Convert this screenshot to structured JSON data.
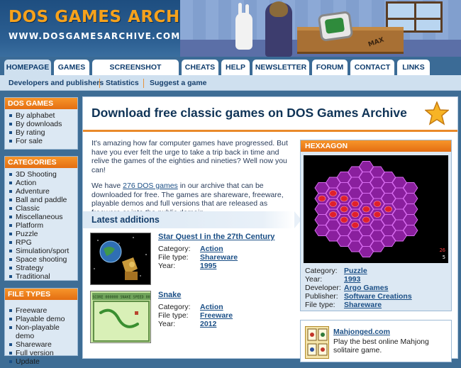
{
  "header": {
    "title": "DOS GAMES ARCHIVE",
    "url": "WWW.DOSGAMESARCHIVE.COM",
    "scene_sign": "MAX"
  },
  "nav": {
    "tabs": [
      {
        "label": "HOMEPAGE",
        "active": true
      },
      {
        "label": "GAMES"
      },
      {
        "label": "SCREENSHOT GALLERY"
      },
      {
        "label": "CHEATS"
      },
      {
        "label": "HELP"
      },
      {
        "label": "NEWSLETTER"
      },
      {
        "label": "FORUM"
      },
      {
        "label": "CONTACT"
      },
      {
        "label": "LINKS"
      }
    ],
    "subnav": [
      "Developers and publishers",
      "Statistics",
      "Suggest a game"
    ]
  },
  "sidebar": {
    "dos_games": {
      "title": "DOS GAMES",
      "items": [
        "By alphabet",
        "By downloads",
        "By rating",
        "For sale"
      ]
    },
    "categories": {
      "title": "CATEGORIES",
      "items": [
        "3D Shooting",
        "Action",
        "Adventure",
        "Ball and paddle",
        "Classic",
        "Miscellaneous",
        "Platform",
        "Puzzle",
        "RPG",
        "Simulation/sport",
        "Space shooting",
        "Strategy",
        "Traditional"
      ]
    },
    "file_types": {
      "title": "FILE TYPES",
      "items": [
        "Freeware",
        "Playable demo",
        "Non-playable demo",
        "Shareware",
        "Full version",
        "Update"
      ]
    }
  },
  "main": {
    "title": "Download free classic games on DOS Games Archive",
    "intro_p1": "It's amazing how far computer games have progressed. But have you ever felt the urge to take a trip back in time and relive the games of the eighties and nineties? Well now you can!",
    "intro_p2_pre": "We have ",
    "intro_p2_link": "276 DOS games",
    "intro_p2_post": " in our archive that can be downloaded for free. The games are shareware, freeware, playable demos and full versions that are released as freeware or into the public domain.",
    "latest_title": "Latest additions",
    "labels": {
      "category": "Category:",
      "file_type": "File type:",
      "year": "Year:"
    },
    "games": [
      {
        "title": "Star Quest I in the 27th Century",
        "category": "Action",
        "file_type": "Shareware",
        "year": "1995"
      },
      {
        "title": "Snake",
        "category": "Action",
        "file_type": "Freeware",
        "year": "2012",
        "thumb_text": "SCORE 000000  SNAKE  SPEED 00"
      }
    ]
  },
  "featured": {
    "title": "HEXXAGON",
    "score": "26",
    "score2": "5",
    "labels": {
      "category": "Category:",
      "year": "Year:",
      "developer": "Developer:",
      "publisher": "Publisher:",
      "file_type": "File type:"
    },
    "category": "Puzzle",
    "year": "1993",
    "developer": "Argo Games",
    "publisher": "Software Creations",
    "file_type": "Shareware"
  },
  "mahjong": {
    "title": "Mahjonged.com",
    "desc": "Play the best online Mahjong solitaire game."
  }
}
